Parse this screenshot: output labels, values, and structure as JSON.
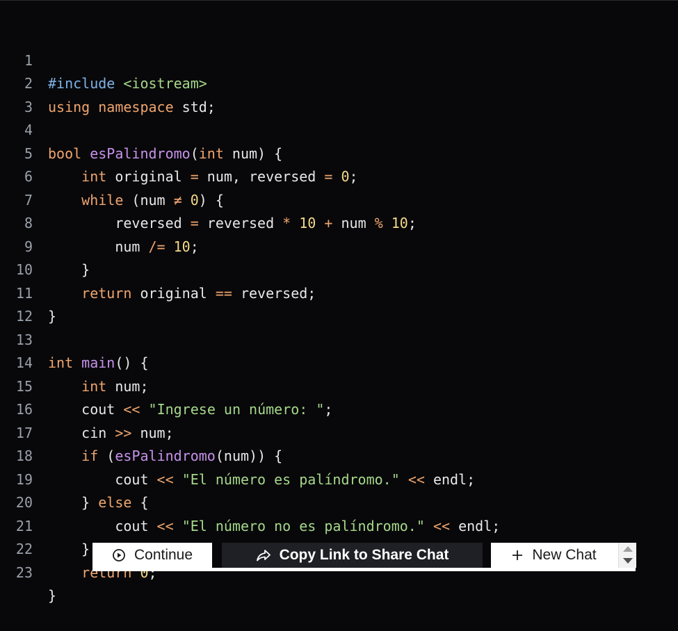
{
  "code": {
    "lines": [
      {
        "n": "1"
      },
      {
        "n": "2"
      },
      {
        "n": "3"
      },
      {
        "n": "4"
      },
      {
        "n": "5"
      },
      {
        "n": "6"
      },
      {
        "n": "7"
      },
      {
        "n": "8"
      },
      {
        "n": "9"
      },
      {
        "n": "10"
      },
      {
        "n": "11"
      },
      {
        "n": "12"
      },
      {
        "n": "13"
      },
      {
        "n": "14"
      },
      {
        "n": "15"
      },
      {
        "n": "16"
      },
      {
        "n": "17"
      },
      {
        "n": "18"
      },
      {
        "n": "19"
      },
      {
        "n": "20"
      },
      {
        "n": "21"
      },
      {
        "n": "22"
      },
      {
        "n": "23"
      }
    ],
    "t": {
      "include": "#include",
      "iostream": "<iostream>",
      "using": "using",
      "namespace": "namespace",
      "std": " std;",
      "bool": "bool",
      "esPalindromo": "esPalindromo",
      "int": "int",
      "while": "while",
      "return": "return",
      "main": "main",
      "cout": "cout",
      "cin": "cin",
      "if": "if",
      "else": "else",
      "endl": " endl;",
      "str_ingrese": "\"Ingrese un número: \"",
      "str_es": "\"El número es palíndromo.\"",
      "str_noes": "\"El número no es palíndromo.\""
    }
  },
  "toolbar": {
    "continue_label": "Continue",
    "share_label": "Copy Link to Share Chat",
    "new_chat_label": "New Chat"
  },
  "colors": {
    "background": "#08080a",
    "keyword": "#f0a56e",
    "function": "#c792ea",
    "number": "#f5d98b",
    "string": "#a6d88a",
    "preprocessor": "#7fb2e6"
  }
}
